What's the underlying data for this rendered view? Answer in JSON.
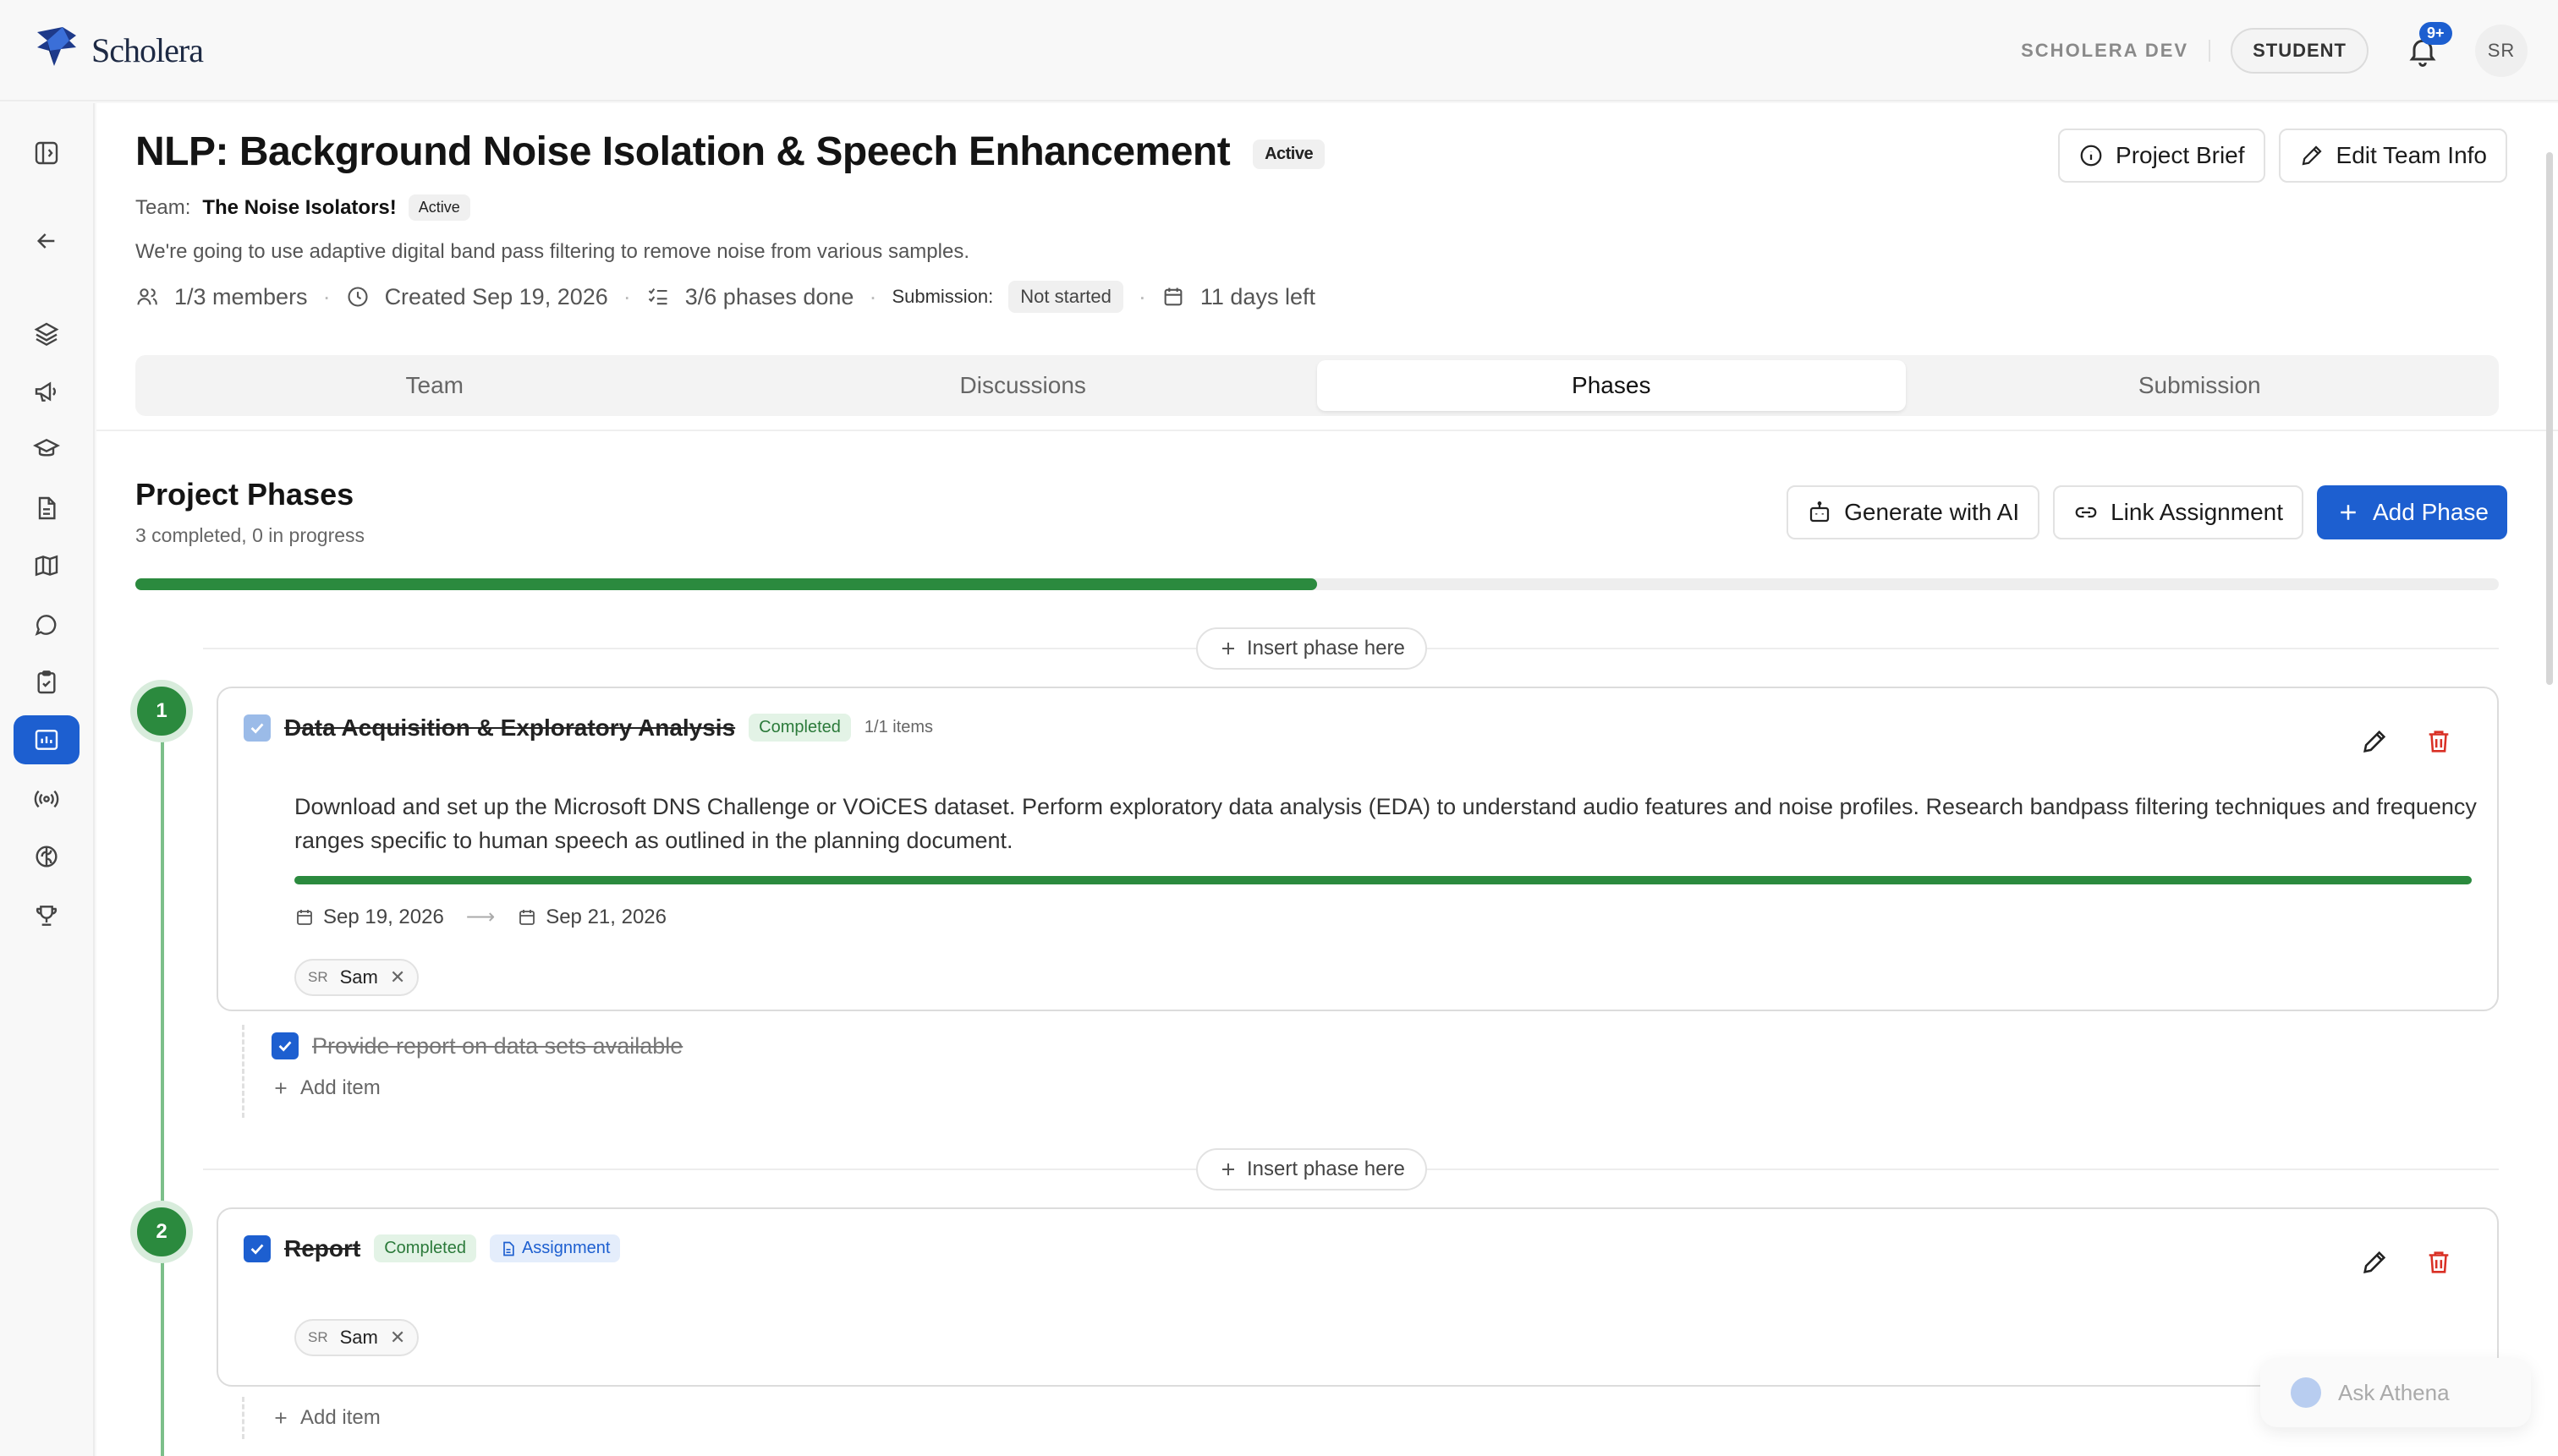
{
  "app": {
    "brand": "Scholera",
    "env_label": "SCHOLERA DEV",
    "role_label": "STUDENT",
    "notification_count": "9+",
    "user_initials": "SR"
  },
  "sidebar": {
    "items": [
      {
        "name": "toggle-sidebar",
        "icon": "panel-icon"
      },
      {
        "name": "back",
        "icon": "arrow-left-icon"
      },
      {
        "name": "layers",
        "icon": "layers-icon"
      },
      {
        "name": "announcements",
        "icon": "megaphone-icon"
      },
      {
        "name": "courses",
        "icon": "graduation-cap-icon"
      },
      {
        "name": "documents",
        "icon": "file-icon"
      },
      {
        "name": "roadmap",
        "icon": "map-icon"
      },
      {
        "name": "messages",
        "icon": "chat-icon"
      },
      {
        "name": "assignments",
        "icon": "clipboard-icon"
      },
      {
        "name": "projects",
        "icon": "project-board-icon",
        "active": true
      },
      {
        "name": "live",
        "icon": "broadcast-icon"
      },
      {
        "name": "ai",
        "icon": "brain-icon"
      },
      {
        "name": "leaderboard",
        "icon": "trophy-icon"
      }
    ]
  },
  "project": {
    "title": "NLP: Background Noise Isolation & Speech Enhancement",
    "status": "Active",
    "team_label": "Team:",
    "team_name": "The Noise Isolators!",
    "team_status": "Active",
    "description": "We're going to use adaptive digital band pass filtering to remove noise from various samples.",
    "members": "1/3 members",
    "created": "Created Sep 19, 2026",
    "phases_done": "3/6 phases done",
    "submission_label": "Submission:",
    "submission_status": "Not started",
    "days_left": "11 days left"
  },
  "actions": {
    "project_brief": "Project Brief",
    "edit_team": "Edit Team Info"
  },
  "tabs": [
    {
      "label": "Team"
    },
    {
      "label": "Discussions"
    },
    {
      "label": "Phases",
      "active": true
    },
    {
      "label": "Submission"
    }
  ],
  "phases_section": {
    "title": "Project Phases",
    "subtitle": "3 completed, 0 in progress",
    "overall_progress": 0.5,
    "generate_ai": "Generate with AI",
    "link_assignment": "Link Assignment",
    "add_phase": "Add Phase",
    "insert_label": "Insert phase here",
    "add_item_label": "Add item"
  },
  "phases": [
    {
      "number": "1",
      "name": "Data Acquisition & Exploratory Analysis",
      "status": "Completed",
      "items_count": "1/1 items",
      "description": "Download and set up the Microsoft DNS Challenge or VOiCES dataset. Perform exploratory data analysis (EDA) to understand audio features and noise profiles. Research bandpass filtering techniques and frequency ranges specific to human speech as outlined in the planning document.",
      "progress": 1.0,
      "start_date": "Sep 19, 2026",
      "end_date": "Sep 21, 2026",
      "assignee_initials": "SR",
      "assignee_name": "Sam",
      "checklist": [
        "Provide report on data sets available"
      ]
    },
    {
      "number": "2",
      "name": "Report",
      "status": "Completed",
      "tag": "Assignment",
      "assignee_initials": "SR",
      "assignee_name": "Sam"
    }
  ],
  "assistant": {
    "label": "Ask Athena"
  },
  "colors": {
    "primary": "#1d5fd0",
    "success": "#2b8a3e",
    "danger": "#d93025"
  }
}
